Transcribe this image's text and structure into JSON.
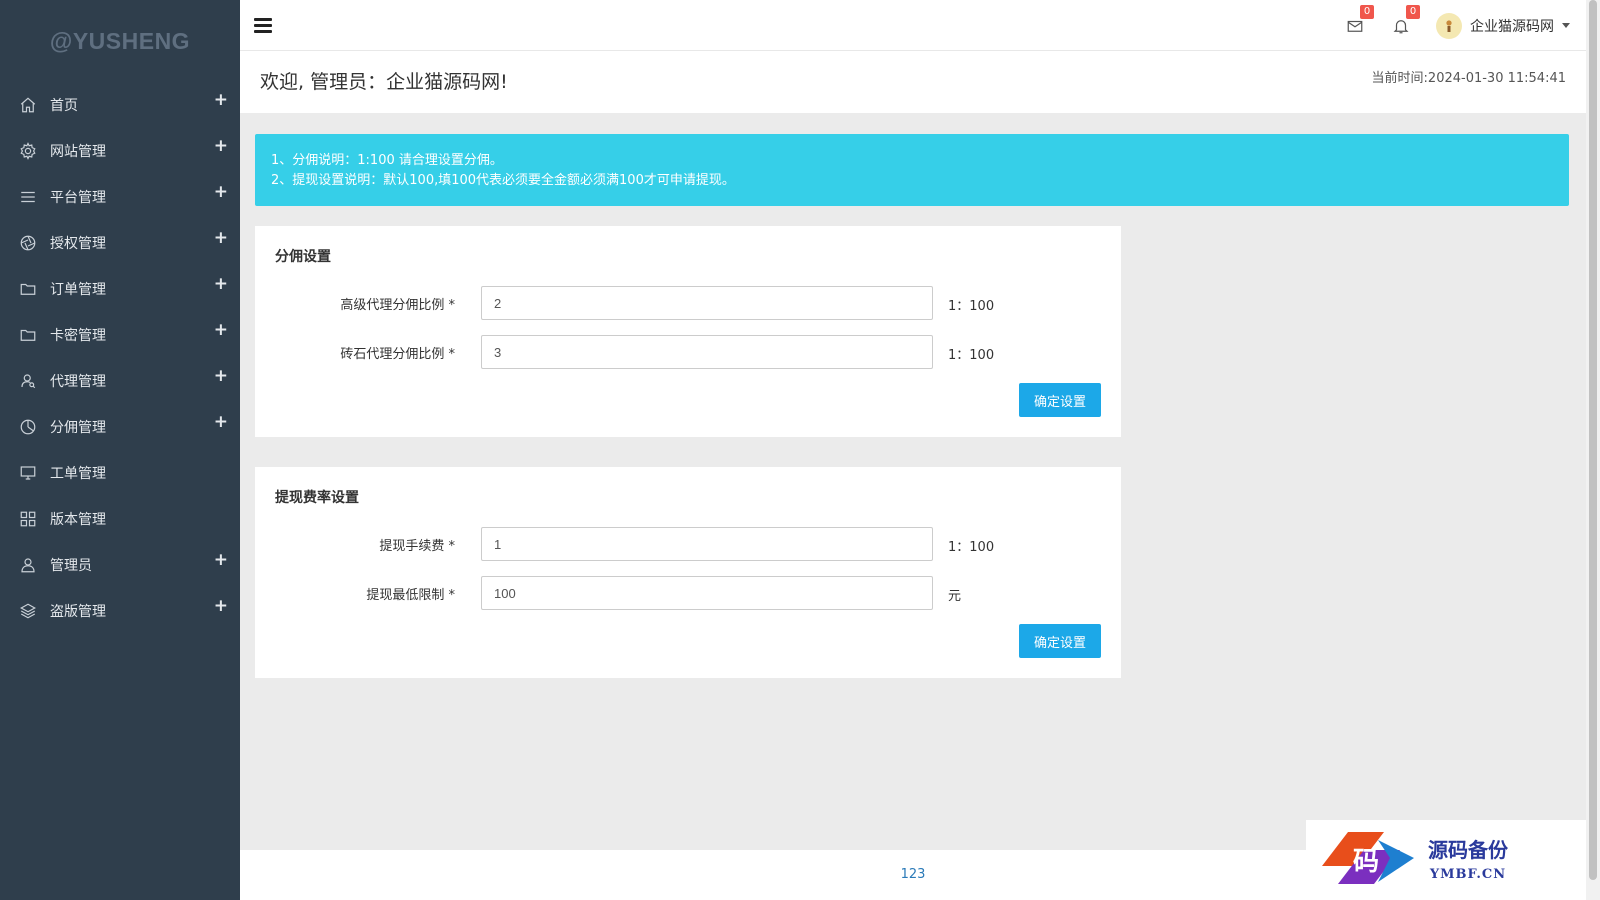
{
  "sidebar": {
    "brand": "@YUSHENG",
    "items": [
      {
        "label": "首页",
        "icon": "home-icon",
        "expandable": true
      },
      {
        "label": "网站管理",
        "icon": "gear-icon",
        "expandable": true
      },
      {
        "label": "平台管理",
        "icon": "list-icon",
        "expandable": true
      },
      {
        "label": "授权管理",
        "icon": "aperture-icon",
        "expandable": true
      },
      {
        "label": "订单管理",
        "icon": "folder-icon",
        "expandable": true
      },
      {
        "label": "卡密管理",
        "icon": "folder-icon",
        "expandable": true
      },
      {
        "label": "代理管理",
        "icon": "user-search-icon",
        "expandable": true
      },
      {
        "label": "分佣管理",
        "icon": "pie-icon",
        "expandable": true
      },
      {
        "label": "工单管理",
        "icon": "monitor-icon",
        "expandable": false
      },
      {
        "label": "版本管理",
        "icon": "grid-icon",
        "expandable": false
      },
      {
        "label": "管理员",
        "icon": "user-icon",
        "expandable": true
      },
      {
        "label": "盗版管理",
        "icon": "layers-icon",
        "expandable": true
      }
    ],
    "plus": "+"
  },
  "topbar": {
    "mail_badge": "0",
    "bell_badge": "0",
    "user_name": "企业猫源码网"
  },
  "welcome": {
    "text": "欢迎, 管理员：企业猫源码网!",
    "time": "当前时间:2024-01-30 11:54:41"
  },
  "alert": {
    "line1": "1、分佣说明：1:100 请合理设置分佣。",
    "line2": "2、提现设置说明：默认100,填100代表必须要全金额必须满100才可申请提现。"
  },
  "commission": {
    "title": "分佣设置",
    "senior_label": "高级代理分佣比例 *",
    "senior_value": "2",
    "senior_suffix": "1：100",
    "diamond_label": "砖石代理分佣比例 *",
    "diamond_value": "3",
    "diamond_suffix": "1：100",
    "button": "确定设置"
  },
  "withdraw": {
    "title": "提现费率设置",
    "fee_label": "提现手续费 *",
    "fee_value": "1",
    "fee_suffix": "1：100",
    "min_label": "提现最低限制 *",
    "min_value": "100",
    "min_suffix": "元",
    "button": "确定设置"
  },
  "footer": {
    "text": "123"
  },
  "watermark": {
    "logo_char": "码",
    "cn": "源码备份",
    "en": "YMBF.CN"
  },
  "colors": {
    "sidebar_bg": "#2f3e4c",
    "alert_bg": "#36cfe8",
    "button_bg": "#1ca8e8",
    "badge_bg": "#f0564c"
  }
}
